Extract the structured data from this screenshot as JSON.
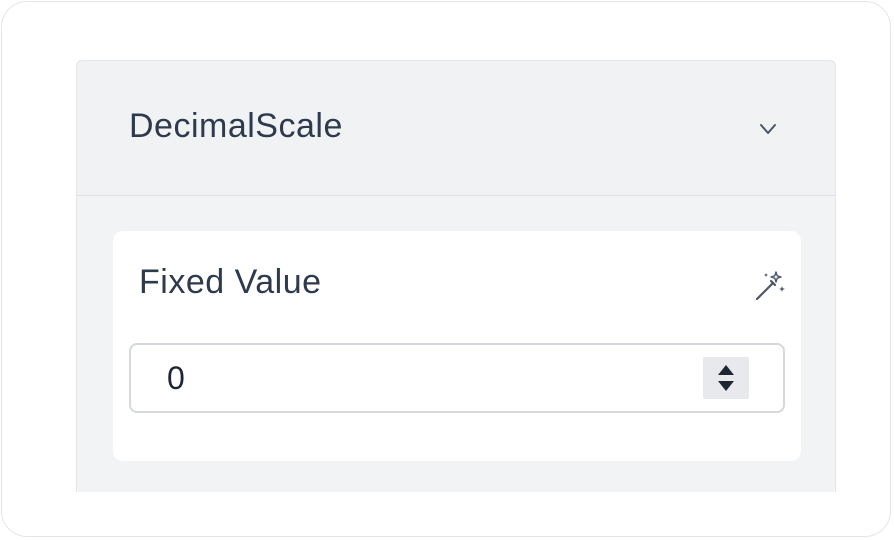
{
  "panel": {
    "title": "DecimalScale",
    "toggle_icon": "chevron-down-icon"
  },
  "field": {
    "label": "Fixed Value",
    "action_icon": "magic-wand-icon",
    "value": "0",
    "stepper_icon": "stepper-arrows-icon"
  },
  "colors": {
    "text": "#2e3a4d",
    "panel_bg": "#f2f3f5",
    "card_bg": "#ffffff",
    "border": "#e3e5e8"
  }
}
